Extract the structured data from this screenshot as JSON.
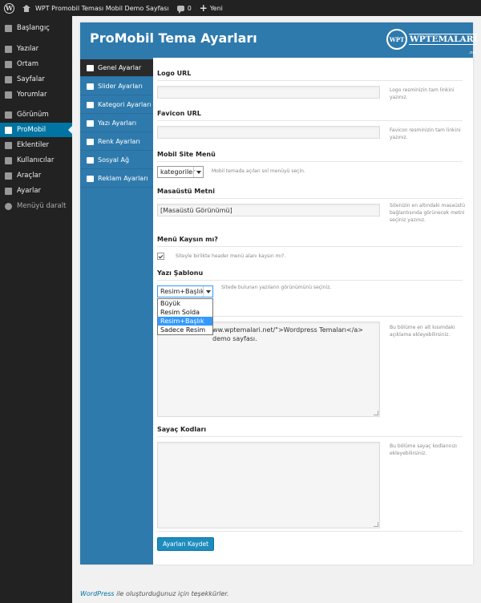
{
  "admin_bar": {
    "site_title": "WPT Promobil Teması Mobil Demo Sayfası",
    "comments_count": "0",
    "new_label": "Yeni"
  },
  "sidebar": {
    "items": [
      {
        "label": "Başlangıç",
        "icon": "dashboard-icon"
      },
      {
        "label": "Yazılar",
        "icon": "pin-icon"
      },
      {
        "label": "Ortam",
        "icon": "media-icon"
      },
      {
        "label": "Sayfalar",
        "icon": "pages-icon"
      },
      {
        "label": "Yorumlar",
        "icon": "comments-icon"
      },
      {
        "label": "Görünüm",
        "icon": "appearance-icon"
      },
      {
        "label": "ProMobil",
        "icon": "mobile-icon"
      },
      {
        "label": "Eklentiler",
        "icon": "plugins-icon"
      },
      {
        "label": "Kullanıcılar",
        "icon": "users-icon"
      },
      {
        "label": "Araçlar",
        "icon": "tools-icon"
      },
      {
        "label": "Ayarlar",
        "icon": "settings-icon"
      },
      {
        "label": "Menüyü daralt",
        "icon": "collapse-icon"
      }
    ]
  },
  "panel": {
    "title": "ProMobil Tema Ayarları",
    "brand_badge": "WPT",
    "brand_name": "WPTEMALARI",
    "brand_tld": ".net"
  },
  "tabs": [
    {
      "label": "Genel Ayarlar",
      "icon": "home-icon"
    },
    {
      "label": "Slider Ayarları",
      "icon": "slider-icon"
    },
    {
      "label": "Kategori Ayarları",
      "icon": "folder-icon"
    },
    {
      "label": "Yazı Ayarları",
      "icon": "pencil-icon"
    },
    {
      "label": "Renk Ayarları",
      "icon": "brush-icon"
    },
    {
      "label": "Sosyal Ağ",
      "icon": "facebook-icon"
    },
    {
      "label": "Reklam Ayarları",
      "icon": "ad-icon"
    }
  ],
  "fields": {
    "logo": {
      "label": "Logo URL",
      "value": "",
      "desc": "Logo resminizin tam linkini yazınız."
    },
    "favicon": {
      "label": "Favicon URL",
      "value": "",
      "desc": "Favicon resminizin tam linkini yazınız."
    },
    "mobile_menu": {
      "label": "Mobil Site Menü",
      "selected": "kategoriler",
      "desc": "Mobil temada açılan sol menüyü seçin."
    },
    "desktop_text": {
      "label": "Masaüstü Metni",
      "value": "[Masaüstü Görünümü]",
      "desc": "Sitenizin en altındaki masaüstü bağlantısında görünecek metni seçiniz yazınız."
    },
    "menu_hide": {
      "label": "Menü Kaysın mı?",
      "checked": true,
      "desc": "Siteyle birlikte header menü alanı kaysın mı?."
    },
    "post_template": {
      "label": "Yazı Şablonu",
      "selected": "Resim+Başlık",
      "desc": "Sitede bulunan yazıların görünümünü seçiniz.",
      "options": [
        "Büyük",
        "Resim Solda",
        "Resim+Başlık",
        "Sadece Resim"
      ],
      "highlighted": "Resim+Başlık"
    },
    "footer_text": {
      "value_visible": "ww.wptemalari.net/\">Wordpress Temaları</a> demo sayfası.",
      "desc": "Bu bölüme en alt kısımdaki açıklama ekleyebilirsiniz."
    },
    "counter": {
      "label": "Sayaç Kodları",
      "value": "",
      "desc": "Bu bölüme sayaç kodlarınızı ekleyebilirsiniz."
    }
  },
  "save_button": "Ayarları Kaydet",
  "footer": {
    "link": "WordPress",
    "text": " ile oluşturduğunuz için teşekkürler."
  }
}
